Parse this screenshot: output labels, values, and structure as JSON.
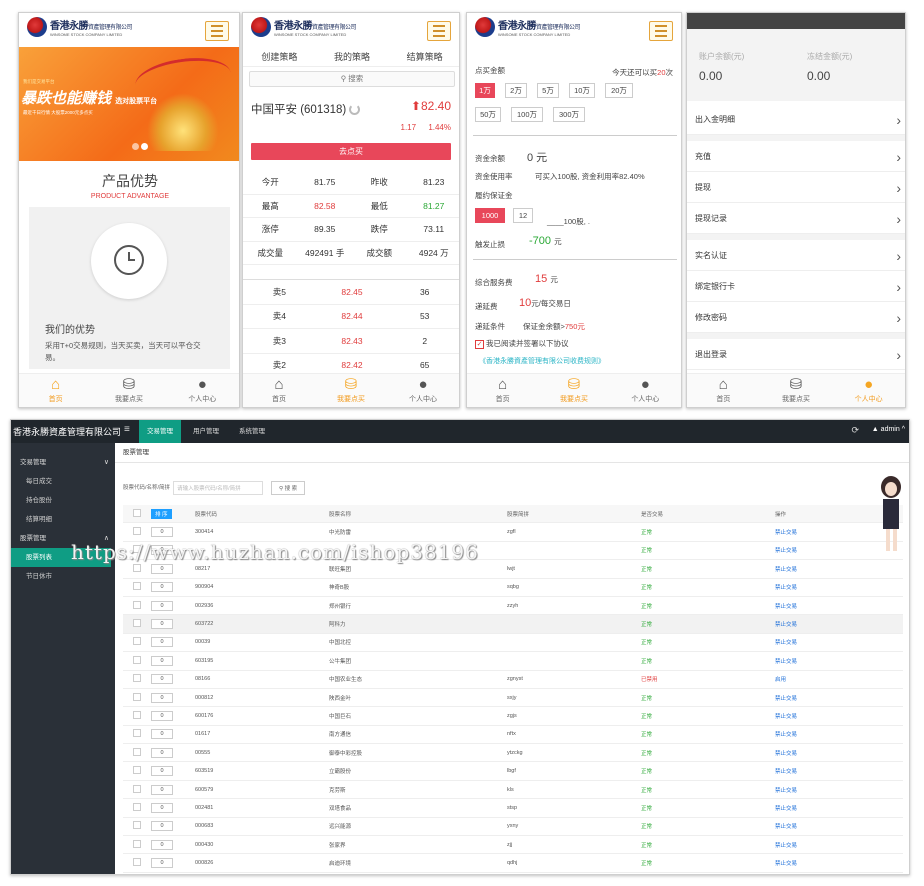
{
  "brand": {
    "cn": "香港永勝",
    "cn_small": "資產管理有限公司",
    "en": "WINSOME STOCK COMPANY LIMITED"
  },
  "tabbar": [
    {
      "label": "首页",
      "icon": "home-icon"
    },
    {
      "label": "我要点买",
      "icon": "coins-icon"
    },
    {
      "label": "个人中心",
      "icon": "user-icon"
    }
  ],
  "p1": {
    "banner": {
      "small": "我们是交易平台",
      "big": "暴跌也能赚钱",
      "big2": "选对股票平台",
      "sub": "最近千日行情  大股票2000元多点买"
    },
    "title": "产品优势",
    "sub_en": "PRODUCT ADVANTAGE",
    "card_title": "我们的优势",
    "card_desc": "采用T+0交易规则，当天买卖，当天可以平仓交易。"
  },
  "p2": {
    "tabs": [
      "创建策略",
      "我的策略",
      "结算策略"
    ],
    "search": "搜索",
    "stock": "中国平安 (601318)",
    "price": "82.40",
    "change": "1.17",
    "change_pct": "1.44%",
    "buy": "去点买",
    "quotes": [
      [
        "今开",
        "81.75",
        "昨收",
        "81.23"
      ],
      [
        "最高",
        "82.58",
        "最低",
        "81.27"
      ],
      [
        "涨停",
        "89.35",
        "跌停",
        "73.11"
      ],
      [
        "成交量",
        "492491 手",
        "成交额",
        "4924 万"
      ]
    ],
    "orderbook": [
      [
        "卖5",
        "82.45",
        "36"
      ],
      [
        "卖4",
        "82.44",
        "53"
      ],
      [
        "卖3",
        "82.43",
        "2"
      ],
      [
        "卖2",
        "82.42",
        "65"
      ]
    ]
  },
  "p3": {
    "label_amt": "点买金额",
    "hint_pre": "今天还可以买",
    "hint_num": "20",
    "hint_unit": "次",
    "chips": [
      "1万",
      "2万",
      "5万",
      "10万",
      "20万",
      "50万",
      "100万",
      "300万"
    ],
    "bal_label": "资金余额",
    "bal_value": "0 元",
    "use_label": "资金使用率",
    "use_text": "可买入100股, 资金利用率82.40%",
    "margin_label": "履约保证金",
    "margin_chips": [
      "1000",
      "12"
    ],
    "margin_tail": "____100股, .",
    "stop_label": "触发止损",
    "stop_value": "-700",
    "stop_unit": "元",
    "fee_label": "综合服务费",
    "fee_value": "15",
    "fee_unit": "元",
    "delay_label": "递延费",
    "delay_value": "10",
    "delay_unit": "元/每交易日",
    "cond_label": "递延条件",
    "cond_text": "保证金余额>",
    "cond_value": "750元",
    "agree": "我已阅读并签署以下协议",
    "agree_link": "《香港永勝資產管理有限公司收费规则》"
  },
  "p4": {
    "acct_label": "账户余额(元)",
    "acct_value": "0.00",
    "frozen_label": "冻结金额(元)",
    "frozen_value": "0.00",
    "menu": [
      "出入金明细",
      "充值",
      "提现",
      "提现记录",
      "实名认证",
      "绑定银行卡",
      "修改密码",
      "退出登录"
    ]
  },
  "admin": {
    "brand": "香港永勝資產管理有限公司",
    "nav": [
      "交易管理",
      "用户管理",
      "系统管理"
    ],
    "user": "admin",
    "sidebar": [
      {
        "label": "交易管理",
        "arrow": "∨"
      },
      {
        "label": "每日成交"
      },
      {
        "label": "持仓股份"
      },
      {
        "label": "结算明细"
      },
      {
        "label": "股票管理",
        "arrow": "∧"
      },
      {
        "label": "股票列表"
      },
      {
        "label": "节日休市"
      }
    ],
    "crumb": "股票管理",
    "search_label": "股票代码/名称/简拼",
    "search_placeholder": "请输入股票代码/名称/简拼",
    "search_btn": "搜 索",
    "columns": [
      "",
      "排 序",
      "股票代码",
      "股票名称",
      "股票简拼",
      "是否交易",
      "操作"
    ],
    "rows": [
      [
        "0",
        "300414",
        "中光防雷",
        "zgfl",
        "正常",
        "禁止交易"
      ],
      [
        "0",
        "",
        "",
        "",
        "正常",
        "禁止交易"
      ],
      [
        "0",
        "08217",
        "联旺集团",
        "lwjt",
        "正常",
        "禁止交易"
      ],
      [
        "0",
        "900904",
        "神奇B股",
        "sqbg",
        "正常",
        "禁止交易"
      ],
      [
        "0",
        "002936",
        "郑州银行",
        "zzyh",
        "正常",
        "禁止交易"
      ],
      [
        "0",
        "603722",
        "阿科力",
        "",
        "正常",
        "禁止交易"
      ],
      [
        "0",
        "00039",
        "中国北控",
        "",
        "正常",
        "禁止交易"
      ],
      [
        "0",
        "603195",
        "公牛集团",
        "",
        "正常",
        "禁止交易"
      ],
      [
        "0",
        "08166",
        "中国农业生态",
        "zgnyst",
        "已禁用",
        "启用"
      ],
      [
        "0",
        "000812",
        "陕西金叶",
        "sxjy",
        "正常",
        "禁止交易"
      ],
      [
        "0",
        "600176",
        "中国巨石",
        "zgjs",
        "正常",
        "禁止交易"
      ],
      [
        "0",
        "01617",
        "南方通信",
        "nftx",
        "正常",
        "禁止交易"
      ],
      [
        "0",
        "00555",
        "御泰中彩控股",
        "ytzckg",
        "正常",
        "禁止交易"
      ],
      [
        "0",
        "603519",
        "立霸股份",
        "lbgf",
        "正常",
        "禁止交易"
      ],
      [
        "0",
        "600579",
        "克劳斯",
        "kls",
        "正常",
        "禁止交易"
      ],
      [
        "0",
        "002481",
        "双塔食品",
        "stsp",
        "正常",
        "禁止交易"
      ],
      [
        "0",
        "000683",
        "远兴能源",
        "yxny",
        "正常",
        "禁止交易"
      ],
      [
        "0",
        "000430",
        "张家界",
        "zjj",
        "正常",
        "禁止交易"
      ],
      [
        "0",
        "000826",
        "启迪环境",
        "qdhj",
        "正常",
        "禁止交易"
      ]
    ]
  },
  "watermark": "https://www.huzhan.com/ishop38196",
  "colors": {
    "accent": "#e8475a",
    "active_tab": "#f29a1c",
    "admin_green": "#0f9d84",
    "admin_dark": "#20262c"
  }
}
